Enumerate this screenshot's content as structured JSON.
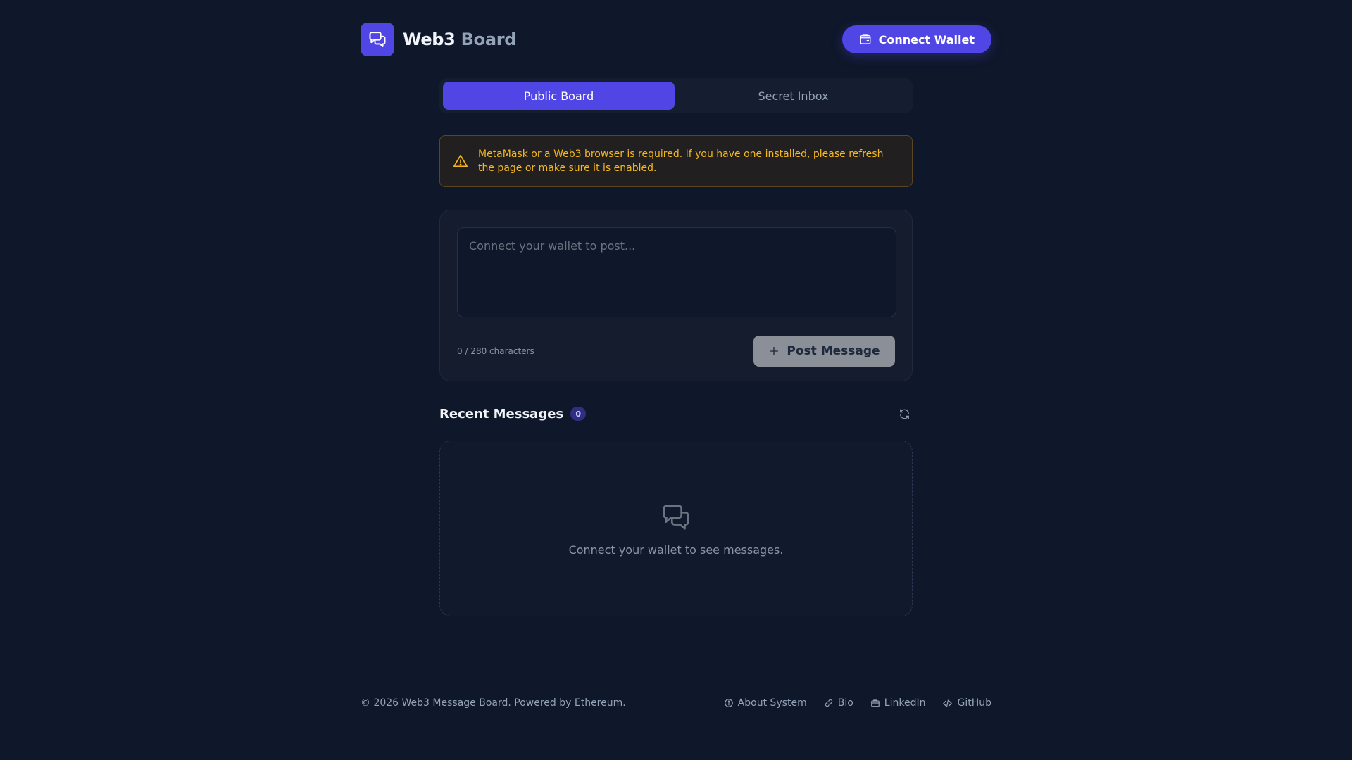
{
  "brand": {
    "name_main": "Web3",
    "name_accent": "Board",
    "logo_icon": "chat-bubbles-icon"
  },
  "header": {
    "connect_label": "Connect Wallet",
    "connect_icon": "wallet-icon"
  },
  "tabs": [
    {
      "label": "Public Board",
      "active": true
    },
    {
      "label": "Secret Inbox",
      "active": false
    }
  ],
  "warning": {
    "icon": "warning-triangle-icon",
    "text": "MetaMask or a Web3 browser is required. If you have one installed, please refresh the page or make sure it is enabled."
  },
  "composer": {
    "placeholder": "Connect your wallet to post...",
    "value": "",
    "char_count": "0 / 280 characters",
    "post_label": "Post Message",
    "post_icon": "plus-icon"
  },
  "recent": {
    "title": "Recent Messages",
    "count": "0",
    "refresh_icon": "refresh-icon",
    "empty_icon": "chat-bubbles-icon",
    "empty_text": "Connect your wallet to see messages."
  },
  "footer": {
    "copyright": "© 2026 Web3 Message Board. Powered by Ethereum.",
    "links": [
      {
        "label": "About System",
        "icon": "info-icon"
      },
      {
        "label": "Bio",
        "icon": "link-icon"
      },
      {
        "label": "LinkedIn",
        "icon": "briefcase-icon"
      },
      {
        "label": "GitHub",
        "icon": "code-icon"
      }
    ]
  },
  "colors": {
    "background": "#0f172a",
    "accent": "#4f46e5",
    "warning": "#f5b81c",
    "card": "#141c2e"
  }
}
